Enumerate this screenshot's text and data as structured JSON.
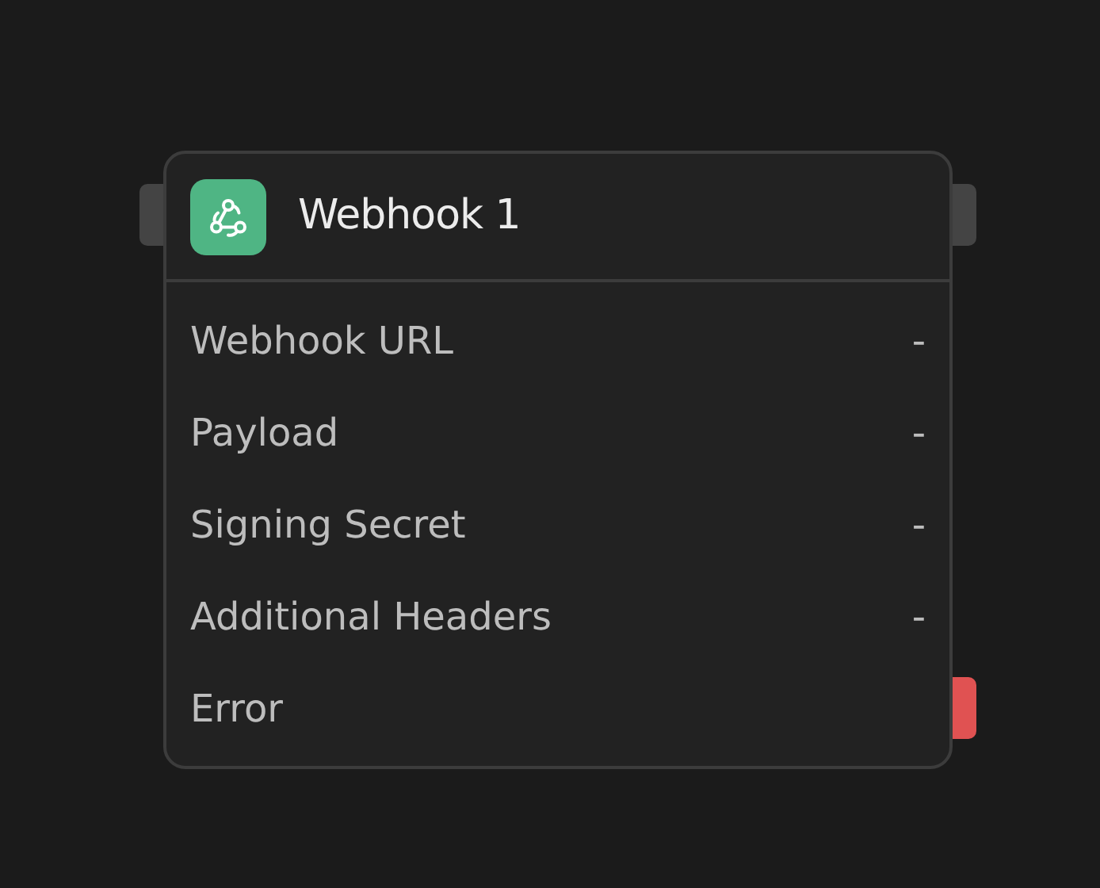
{
  "node": {
    "title": "Webhook 1",
    "rows": [
      {
        "kind": "field",
        "label": "Webhook URL",
        "value": "-"
      },
      {
        "kind": "field",
        "label": "Payload",
        "value": "-"
      },
      {
        "kind": "field",
        "label": "Signing Secret",
        "value": "-"
      },
      {
        "kind": "field",
        "label": "Additional Headers",
        "value": "-"
      },
      {
        "kind": "error",
        "label": "Error"
      }
    ]
  }
}
